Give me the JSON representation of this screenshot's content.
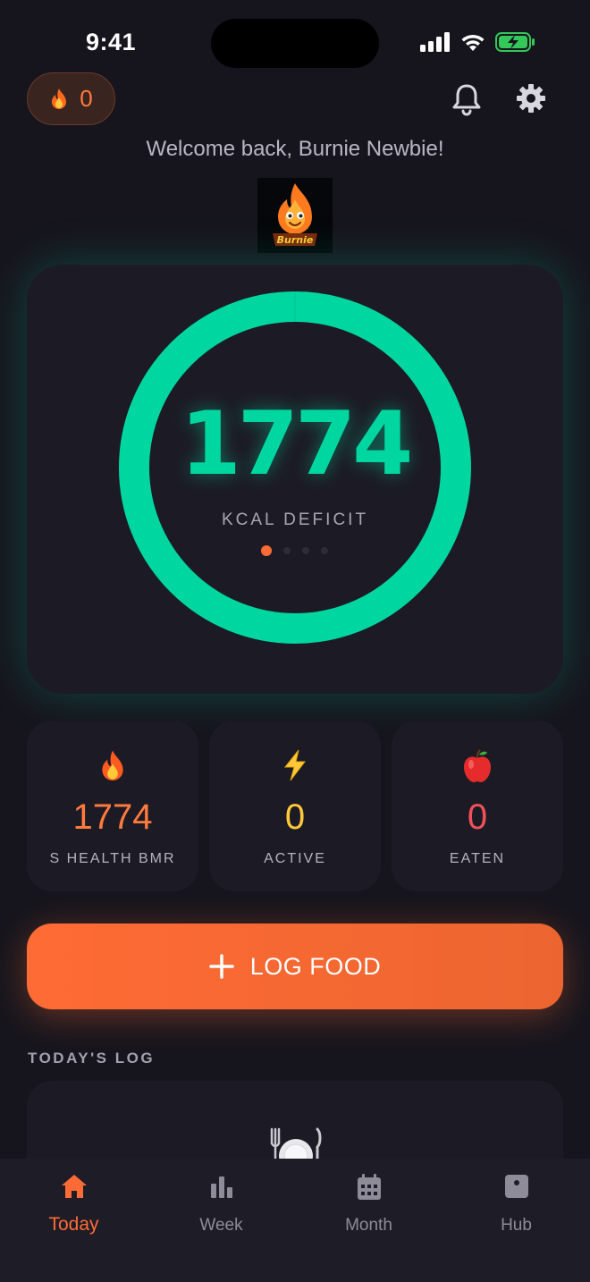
{
  "status_bar": {
    "time": "9:41"
  },
  "header": {
    "streak_count": "0",
    "welcome": "Welcome back, Burnie Newbie!"
  },
  "mascot": {
    "text": "Burnie"
  },
  "ring": {
    "value": "1774",
    "label": "KCAL DEFICIT",
    "progress": 1.0,
    "color": "#00d6a0",
    "page_count": 4,
    "active_page": 0
  },
  "stats": [
    {
      "icon": "fire-icon",
      "value": "1774",
      "label": "S HEALTH BMR",
      "color": "#ff7a3d"
    },
    {
      "icon": "lightning-icon",
      "value": "0",
      "label": "ACTIVE",
      "color": "#ffc93a"
    },
    {
      "icon": "apple-icon",
      "value": "0",
      "label": "EATEN",
      "color": "#f0505a"
    }
  ],
  "actions": {
    "log_food": "LOG FOOD"
  },
  "log": {
    "title": "TODAY'S LOG"
  },
  "tabs": [
    {
      "label": "Today",
      "icon": "home-icon",
      "active": true
    },
    {
      "label": "Week",
      "icon": "bar-chart-icon",
      "active": false
    },
    {
      "label": "Month",
      "icon": "calendar-icon",
      "active": false
    },
    {
      "label": "Hub",
      "icon": "hub-icon",
      "active": false
    }
  ],
  "colors": {
    "background": "#16151d",
    "card": "#1c1b25",
    "accent": "#ff6b35",
    "success": "#00d6a0"
  }
}
